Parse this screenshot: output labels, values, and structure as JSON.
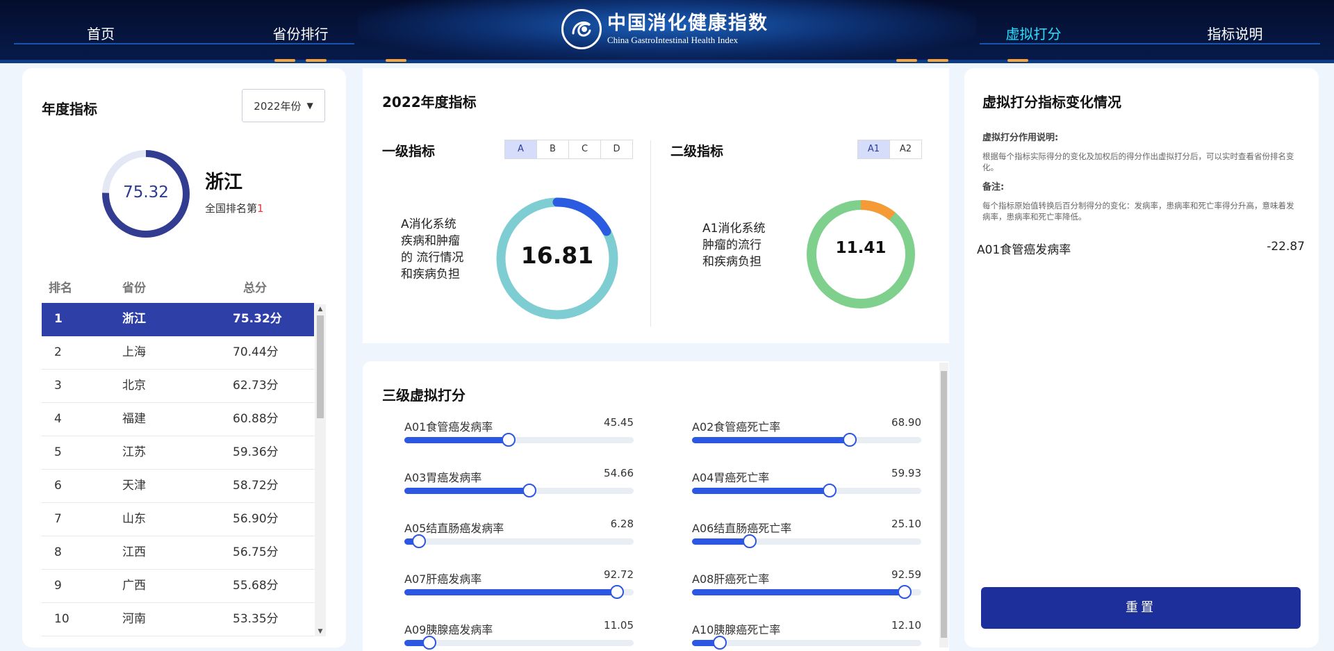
{
  "nav": {
    "home": "首页",
    "province_rank": "省份排行",
    "virtual_score": "虚拟打分",
    "indicator_desc": "指标说明"
  },
  "logo": {
    "title": "中国消化健康指数",
    "subtitle": "China GastroIntestinal Health Index"
  },
  "left": {
    "title": "年度指标",
    "year_select": "2022年份",
    "score": "75.32",
    "score_ratio": 0.7532,
    "province": "浙江",
    "rank_prefix": "全国排名第",
    "rank_num": "1",
    "headers": {
      "rank": "排名",
      "province": "省份",
      "total": "总分"
    },
    "rows": [
      {
        "rank": "1",
        "province": "浙江",
        "score": "75.32分"
      },
      {
        "rank": "2",
        "province": "上海",
        "score": "70.44分"
      },
      {
        "rank": "3",
        "province": "北京",
        "score": "62.73分"
      },
      {
        "rank": "4",
        "province": "福建",
        "score": "60.88分"
      },
      {
        "rank": "5",
        "province": "江苏",
        "score": "59.36分"
      },
      {
        "rank": "6",
        "province": "天津",
        "score": "58.72分"
      },
      {
        "rank": "7",
        "province": "山东",
        "score": "56.90分"
      },
      {
        "rank": "8",
        "province": "江西",
        "score": "56.75分"
      },
      {
        "rank": "9",
        "province": "广西",
        "score": "55.68分"
      },
      {
        "rank": "10",
        "province": "河南",
        "score": "53.35分"
      }
    ]
  },
  "middle": {
    "title": "2022年度指标",
    "level1": {
      "title": "一级指标",
      "tabs": [
        "A",
        "B",
        "C",
        "D"
      ],
      "label": "A消化系统疾病和肿瘤的 流行情况和疾病负担",
      "value": "16.81",
      "highlight_ratio": 0.17,
      "color_main": "#7ecdd3",
      "color_highlight": "#2b5be0"
    },
    "level2": {
      "title": "二级指标",
      "tabs": [
        "A1",
        "A2"
      ],
      "label": "A1消化系统肿瘤的流行和疾病负担",
      "value": "11.41",
      "highlight_ratio": 0.11,
      "color_main": "#7ed08c",
      "color_highlight": "#f59a34"
    },
    "sliders_title": "三级虚拟打分",
    "sliders": [
      {
        "name": "A01食管癌发病率",
        "value": "45.45",
        "pct": 45.45
      },
      {
        "name": "A02食管癌死亡率",
        "value": "68.90",
        "pct": 68.9
      },
      {
        "name": "A03胃癌发病率",
        "value": "54.66",
        "pct": 54.66
      },
      {
        "name": "A04胃癌死亡率",
        "value": "59.93",
        "pct": 59.93
      },
      {
        "name": "A05结直肠癌发病率",
        "value": "6.28",
        "pct": 6.28
      },
      {
        "name": "A06结直肠癌死亡率",
        "value": "25.10",
        "pct": 25.1
      },
      {
        "name": "A07肝癌发病率",
        "value": "92.72",
        "pct": 92.72
      },
      {
        "name": "A08肝癌死亡率",
        "value": "92.59",
        "pct": 92.59
      },
      {
        "name": "A09胰腺癌发病率",
        "value": "11.05",
        "pct": 11.05
      },
      {
        "name": "A10胰腺癌死亡率",
        "value": "12.10",
        "pct": 12.1
      }
    ]
  },
  "right": {
    "title": "虚拟打分指标变化情况",
    "desc_head": "虚拟打分作用说明:",
    "desc_text": "根据每个指标实际得分的变化及加权后的得分作出虚拟打分后，可以实时查看省份排名变化。",
    "note_head": "备注:",
    "note_text": "每个指标原始值转换后百分制得分的变化：发病率，患病率和死亡率得分升高，意味着发病率，患病率和死亡率降低。",
    "change_name": "A01食管癌发病率",
    "change_value": "-22.87",
    "reset": "重置"
  },
  "colors": {
    "nav_active": "#27e2ff",
    "primary": "#2f3fa8",
    "slider": "#2c57e3",
    "reset_btn": "#1c2f9a"
  }
}
